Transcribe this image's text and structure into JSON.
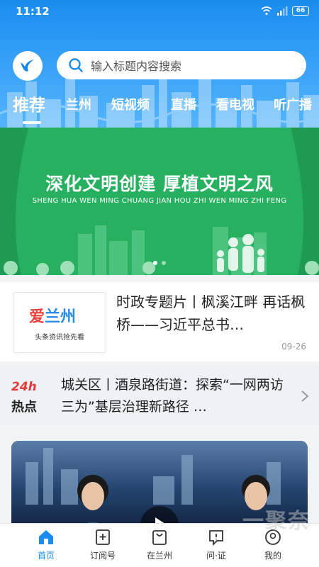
{
  "status_bar": {
    "time": "11:12",
    "battery": "66"
  },
  "search": {
    "placeholder": "输入标题内容搜索"
  },
  "tabs": [
    {
      "label": "推荐",
      "active": true
    },
    {
      "label": "兰州"
    },
    {
      "label": "短视频"
    },
    {
      "label": "直播"
    },
    {
      "label": "看电视"
    },
    {
      "label": "听广播"
    }
  ],
  "banner": {
    "title": "深化文明创建  厚植文明之风",
    "subtitle": "SHENG HUA WEN MING CHUANG JIAN   HOU ZHI WEN MING ZHI FENG"
  },
  "news": {
    "thumb_logo_a": "爱",
    "thumb_logo_b": "兰州",
    "thumb_caption": "头条资讯抢先看",
    "title": "时政专题片丨枫溪江畔 再话枫桥——习近平总书…",
    "date": "09-26"
  },
  "hot": {
    "badge_top": "24h",
    "badge_bottom": "热点",
    "text": "城关区丨酒泉路街道：探索“一网两访三为”基层治理新路径 …"
  },
  "bottom_nav": [
    {
      "label": "首页",
      "icon": "home-icon",
      "active": true
    },
    {
      "label": "订阅号",
      "icon": "subscribe-icon"
    },
    {
      "label": "在兰州",
      "icon": "bag-icon"
    },
    {
      "label": "问·证",
      "icon": "question-icon"
    },
    {
      "label": "我的",
      "icon": "profile-icon"
    }
  ],
  "watermark": "一聚奈",
  "colors": {
    "primary": "#1a8cf0",
    "banner_green": "#27b05f"
  }
}
